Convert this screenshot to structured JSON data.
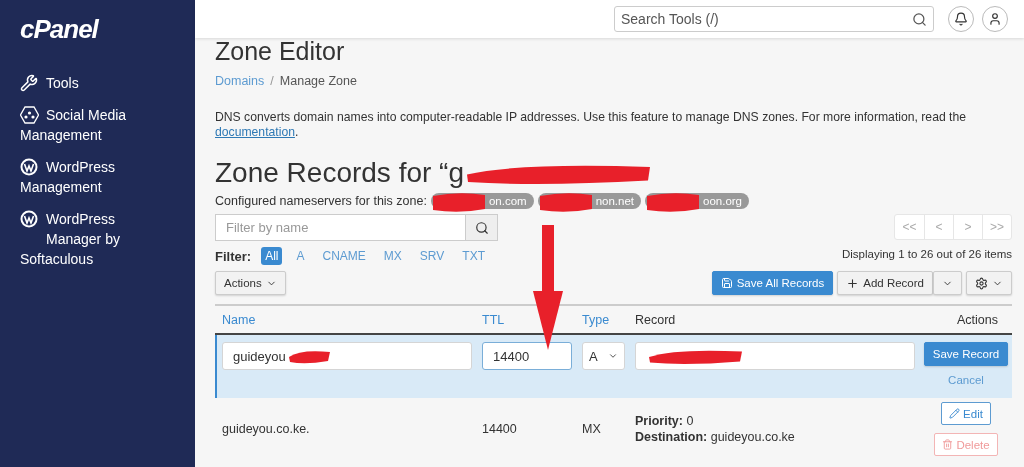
{
  "sidebar": {
    "logo": "cPanel",
    "items": [
      {
        "kind": "tools",
        "label": "Tools"
      },
      {
        "kind": "social",
        "label": "Social Media Management"
      },
      {
        "kind": "wordpress",
        "label": "WordPress Management"
      },
      {
        "kind": "wordpress",
        "label": "WordPress Manager by Softaculous"
      }
    ]
  },
  "header": {
    "search": {
      "placeholder": "Search Tools (/)"
    }
  },
  "page": {
    "title": "Zone Editor",
    "breadcrumb": [
      {
        "label": "Domains",
        "link": true
      },
      {
        "label": "Manage Zone",
        "link": false
      }
    ],
    "breadcrumb_separator": "/",
    "link_end": ".",
    "description": "DNS converts domain names into computer-readable IP addresses. Use this feature to manage DNS zones. For more information, read the",
    "link": "documentation"
  },
  "zone": {
    "heading": "Zone Records for “g",
    "redacted": true,
    "nameservers_label": "Configured nameservers for this zone:",
    "nameservers": [
      {
        "text": "on.com",
        "redacted": true
      },
      {
        "text": "non.net",
        "redacted": true
      },
      {
        "text": "oon.org",
        "redacted": true
      }
    ]
  },
  "filter": {
    "placeholder": "Filter by name",
    "label": "Filter:",
    "types": [
      {
        "label": "All",
        "selected": true
      },
      {
        "label": "A",
        "selected": false
      },
      {
        "label": "CNAME",
        "selected": false
      },
      {
        "label": "MX",
        "selected": false
      },
      {
        "label": "SRV",
        "selected": false
      },
      {
        "label": "TXT",
        "selected": false
      }
    ]
  },
  "pagination": {
    "buttons": [
      "<<",
      "<",
      ">",
      ">>"
    ],
    "summary": "Displaying 1 to 26 out of 26 items"
  },
  "toolbar": {
    "actions": "Actions",
    "save_all": "Save All Records",
    "add": "Add Record"
  },
  "table": {
    "columns": [
      {
        "label": "Name",
        "sortable": true
      },
      {
        "label": "TTL",
        "sortable": true
      },
      {
        "label": "Type",
        "sortable": true
      },
      {
        "label": "Record",
        "sortable": false
      },
      {
        "label": "Actions",
        "sortable": false
      }
    ],
    "edit_row": {
      "name": "guideyou",
      "name_redacted": true,
      "ttl": "14400",
      "type": "A",
      "record_redacted": true,
      "save": "Save Record",
      "cancel": "Cancel"
    },
    "rows": [
      {
        "name": "guideyou.co.ke.",
        "ttl": "14400",
        "type": "MX",
        "details": [
          {
            "label": "Priority:",
            "value": "0"
          },
          {
            "label": "Destination:",
            "value": "guideyou.co.ke"
          }
        ],
        "edit": "Edit",
        "delete": "Delete"
      }
    ]
  },
  "annotation": {
    "kind": "arrow"
  }
}
